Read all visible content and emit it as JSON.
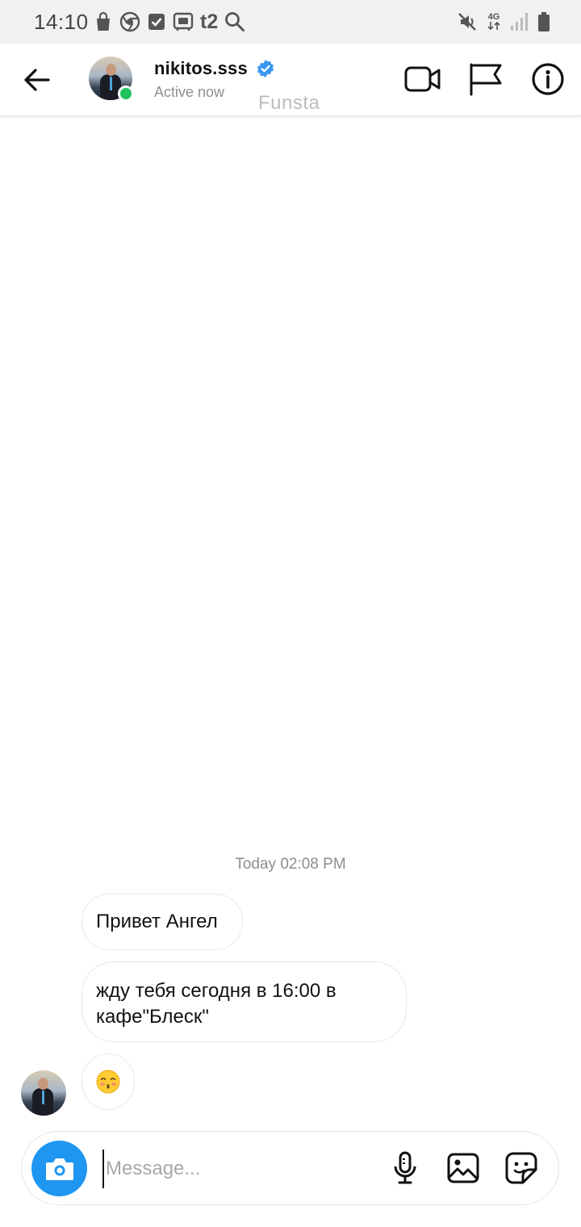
{
  "status_bar": {
    "time": "14:10",
    "carrier": "t2",
    "network": "4G"
  },
  "header": {
    "username": "nikitos.sss",
    "status": "Active now",
    "overlay_text": "Funsta"
  },
  "conversation": {
    "timestamp": "Today 02:08 PM",
    "messages": [
      {
        "text": "Привет Ангел"
      },
      {
        "text": "жду тебя сегодня в 16:00 в кафе\"Блеск\""
      }
    ]
  },
  "composer": {
    "placeholder": "Message..."
  },
  "colors": {
    "accent": "#1e96f2",
    "verified": "#3897f0",
    "online": "#1ec35c",
    "secondary_text": "#8e8e8e"
  },
  "icons": [
    "back-arrow-icon",
    "verified-badge-icon",
    "video-call-icon",
    "flag-icon",
    "info-icon",
    "camera-icon",
    "microphone-icon",
    "gallery-icon",
    "sticker-icon",
    "kissing-face-emoji"
  ]
}
